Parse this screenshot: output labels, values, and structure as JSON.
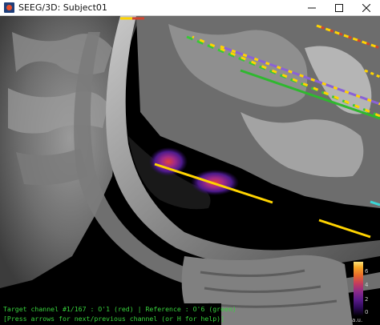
{
  "window": {
    "title": "SEEG/3D: Subject01",
    "controls": {
      "minimize": "minimize-icon",
      "maximize": "maximize-icon",
      "close": "close-icon"
    }
  },
  "status": {
    "line1": "Target channel #1/167 : O'1 (red)  |  Reference : O'6 (green)",
    "line2": "[Press arrows for next/previous channel (or H for help)]"
  },
  "colorbar": {
    "ticks": [
      "6",
      "4",
      "2",
      "0"
    ],
    "unit": "a.u."
  },
  "colors": {
    "status_text": "#37d13c",
    "background": "#000000",
    "electrode_yellow": "#ffd400"
  }
}
